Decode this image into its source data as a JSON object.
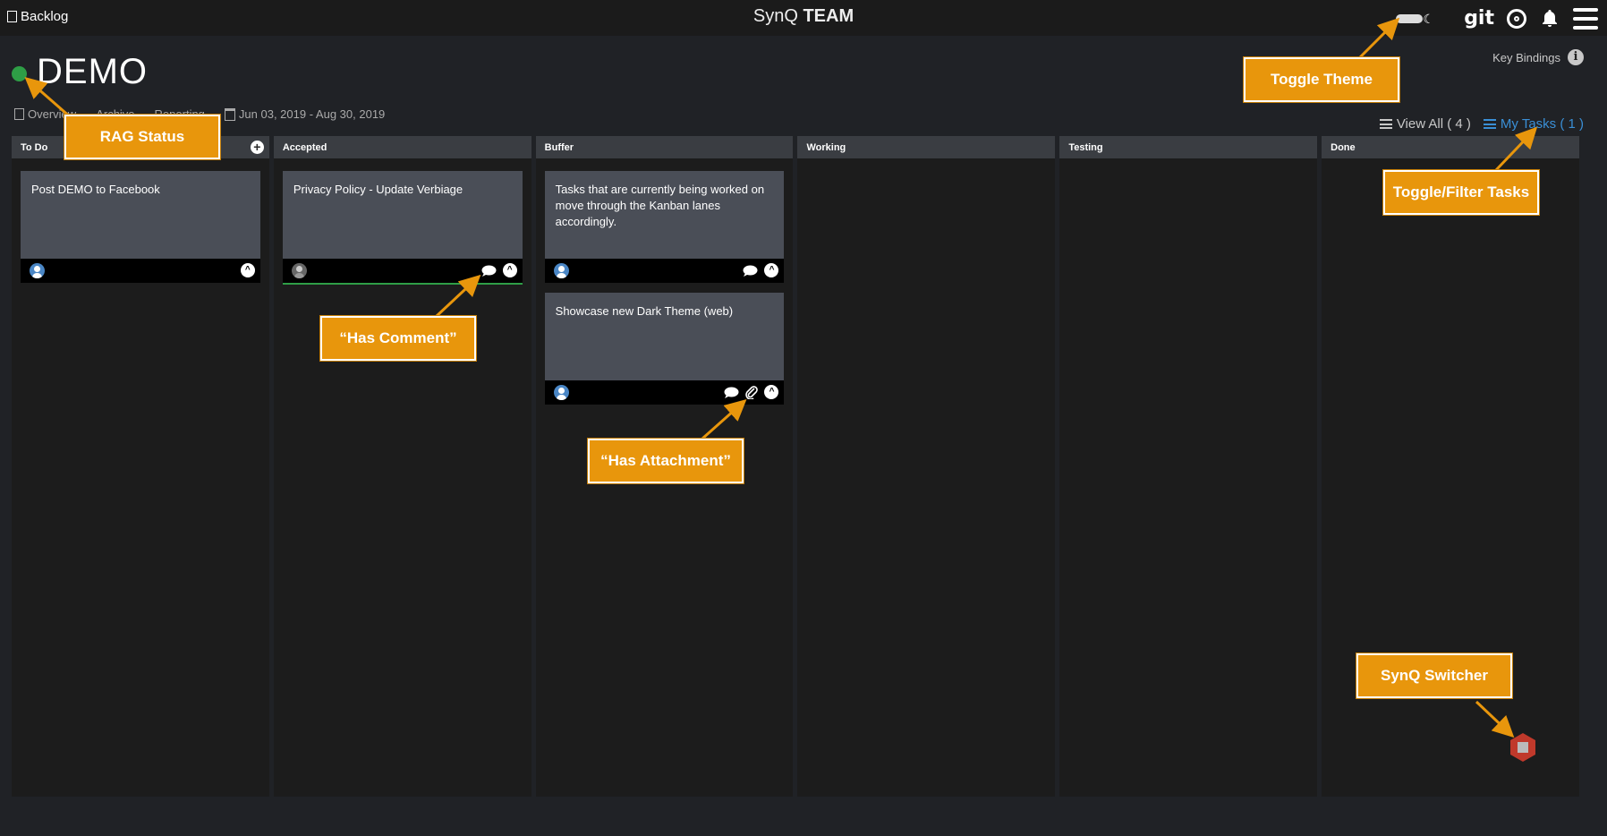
{
  "topbar": {
    "backlog_label": "Backlog",
    "app_title_light": "SynQ",
    "app_title_bold": "TEAM",
    "git_label": "git"
  },
  "project": {
    "name": "DEMO",
    "rag_color": "#2e9e46",
    "key_bindings_label": "Key Bindings",
    "info_symbol": "i"
  },
  "subnav": {
    "overview": "Overview",
    "archive": "Archive",
    "reporting": "Reporting",
    "date_range": "Jun 03, 2019 - Aug 30, 2019"
  },
  "filters": {
    "view_all": "View All ( 4 )",
    "my_tasks": "My Tasks ( 1 )",
    "my_tasks_color": "#3a8fd6"
  },
  "lanes": [
    {
      "label": "To Do"
    },
    {
      "label": "Accepted"
    },
    {
      "label": "Buffer"
    },
    {
      "label": "Working"
    },
    {
      "label": "Testing"
    },
    {
      "label": "Done"
    }
  ],
  "cards": {
    "todo_1": "Post DEMO to Facebook",
    "accepted_1": "Privacy Policy - Update Verbiage",
    "buffer_1": "Tasks that are currently being worked on move through the Kanban lanes accordingly.",
    "buffer_2": "Showcase new Dark Theme (web)"
  },
  "callouts": {
    "rag": "RAG Status",
    "theme": "Toggle Theme",
    "filter": "Toggle/Filter Tasks",
    "comment": "“Has Comment”",
    "attachment": "“Has Attachment”",
    "switcher": "SynQ Switcher"
  },
  "icons": {
    "add": "+",
    "expand": "^",
    "moon": "☾"
  },
  "colors": {
    "accent_orange": "#e8960c",
    "switcher_red": "#c0392b"
  }
}
